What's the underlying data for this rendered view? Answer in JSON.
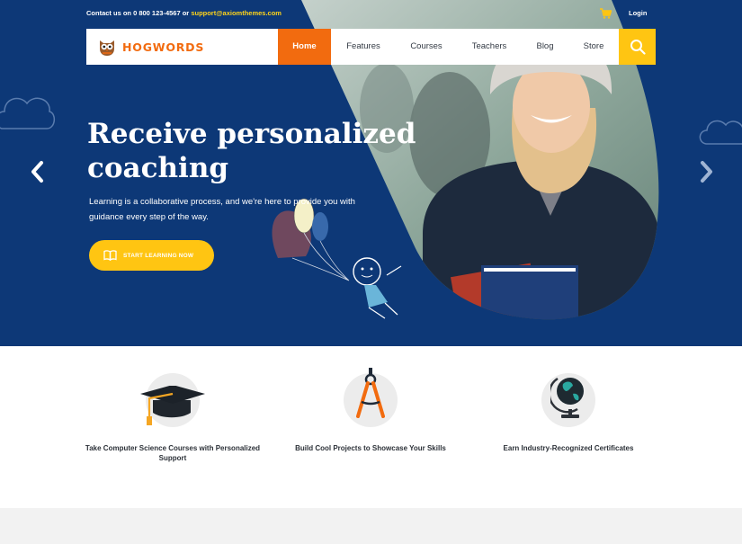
{
  "topbar": {
    "contact_prefix": "Contact us on 0 800 123-4567 or",
    "email": "support@axiomthemes.com",
    "login": "Login"
  },
  "brand": {
    "name": "HOGWORDS"
  },
  "nav": {
    "items": [
      {
        "label": "Home",
        "active": true
      },
      {
        "label": "Features"
      },
      {
        "label": "Courses"
      },
      {
        "label": "Teachers"
      },
      {
        "label": "Blog"
      },
      {
        "label": "Store"
      }
    ]
  },
  "hero": {
    "title": "Receive personalized coaching",
    "subtitle": "Learning is a collaborative process, and we're here to provide you with guidance every step of the way.",
    "cta_label": "START LEARNING NOW"
  },
  "features": [
    {
      "label": "Take Computer Science Courses with Personalized Support",
      "icon": "graduation-cap-icon"
    },
    {
      "label": "Build Cool Projects to Showcase Your Skills",
      "icon": "compass-icon"
    },
    {
      "label": "Earn Industry-Recognized Certificates",
      "icon": "globe-icon"
    }
  ],
  "colors": {
    "hero_bg": "#0d3877",
    "accent_orange": "#f26b0f",
    "accent_yellow": "#ffc512",
    "email_yellow": "#ffd41a"
  }
}
